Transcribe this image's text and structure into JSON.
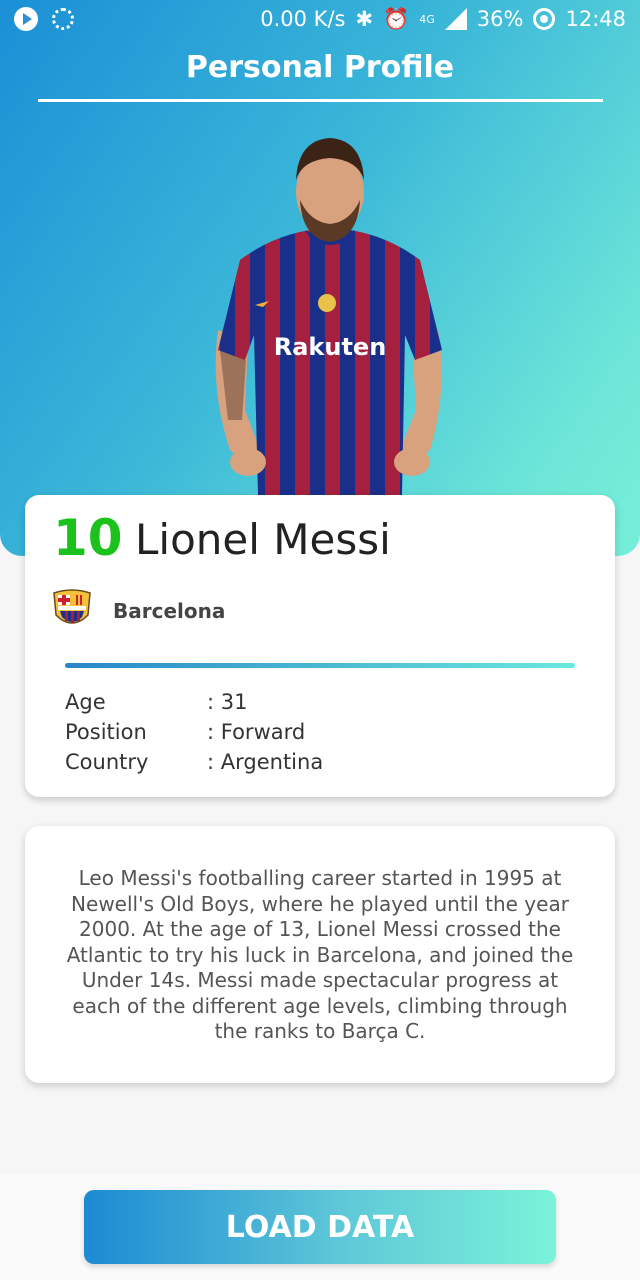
{
  "status_bar": {
    "speed": "0.00 K/s",
    "network": "4G",
    "battery": "36%",
    "time": "12:48"
  },
  "header": {
    "title": "Personal Profile"
  },
  "player": {
    "number": "10",
    "name": "Lionel Messi",
    "club": "Barcelona",
    "stats": [
      {
        "label": "Age",
        "value": ": 31"
      },
      {
        "label": "Position",
        "value": ": Forward"
      },
      {
        "label": "Country",
        "value": ": Argentina"
      }
    ]
  },
  "bio": {
    "text": "Leo Messi's footballing career started in 1995 at Newell's Old Boys, where he played until the year 2000. At the age of 13, Lionel Messi crossed the Atlantic to try his luck in Barcelona, and joined the Under 14s. Messi made spectacular progress at each of the different age levels, climbing through the ranks to Barça C."
  },
  "actions": {
    "load_label": "LOAD DATA"
  },
  "colors": {
    "number": "#1bc21b",
    "gradient_start": "#1b8fd6",
    "gradient_end": "#76efd9"
  }
}
